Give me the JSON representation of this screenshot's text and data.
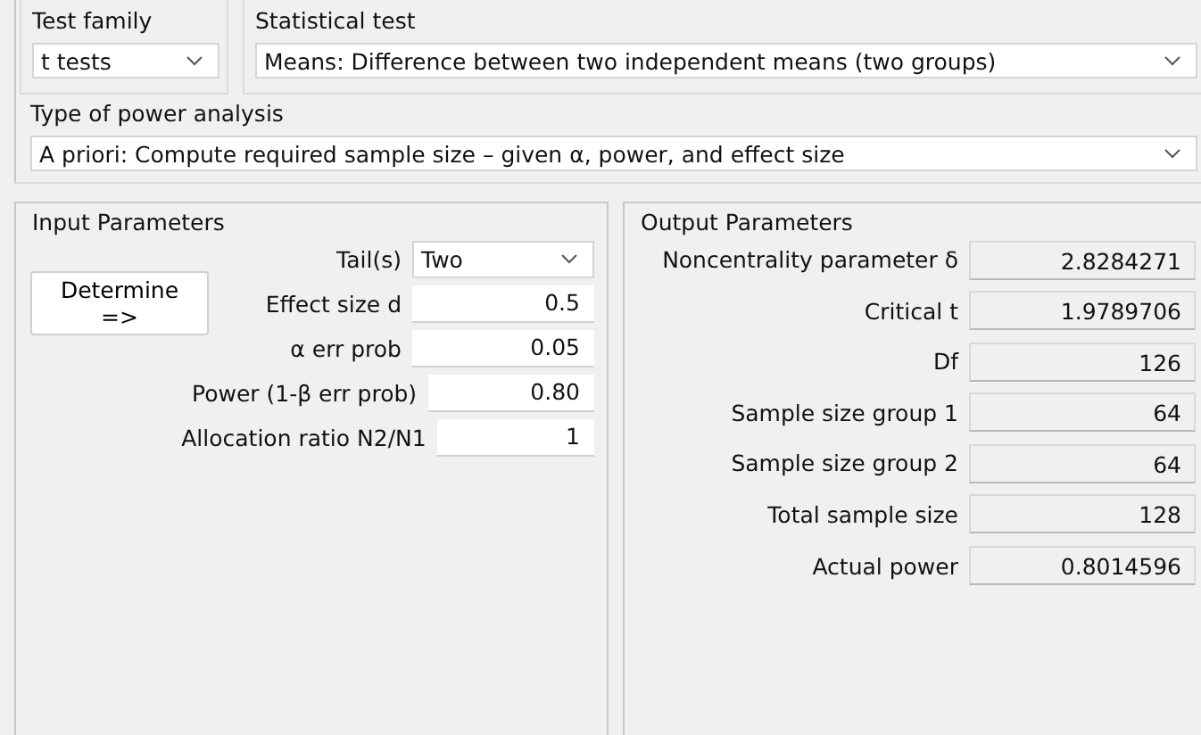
{
  "test_family": {
    "label": "Test family",
    "value": "t tests"
  },
  "statistical_test": {
    "label": "Statistical test",
    "value": "Means: Difference between two independent means (two groups)"
  },
  "power_analysis_type": {
    "label": "Type of power analysis",
    "value": "A priori: Compute required sample size – given α, power, and effect size"
  },
  "input_parameters": {
    "title": "Input Parameters",
    "determine_button": "Determine =>",
    "rows": [
      {
        "kind": "select",
        "label": "Tail(s)",
        "value": "Two"
      },
      {
        "kind": "field",
        "label": "Effect size d",
        "value": "0.5"
      },
      {
        "kind": "field",
        "label": "α err prob",
        "value": "0.05"
      },
      {
        "kind": "field",
        "label": "Power (1-β err prob)",
        "value": "0.80"
      },
      {
        "kind": "field",
        "label": "Allocation ratio N2/N1",
        "value": "1"
      }
    ]
  },
  "output_parameters": {
    "title": "Output Parameters",
    "rows": [
      {
        "label": "Noncentrality parameter δ",
        "value": "2.8284271"
      },
      {
        "label": "Critical t",
        "value": "1.9789706"
      },
      {
        "label": "Df",
        "value": "126"
      },
      {
        "label": "Sample size group 1",
        "value": "64"
      },
      {
        "label": "Sample size group 2",
        "value": "64"
      },
      {
        "label": "Total sample size",
        "value": "128"
      },
      {
        "label": "Actual power",
        "value": "0.8014596"
      }
    ]
  }
}
